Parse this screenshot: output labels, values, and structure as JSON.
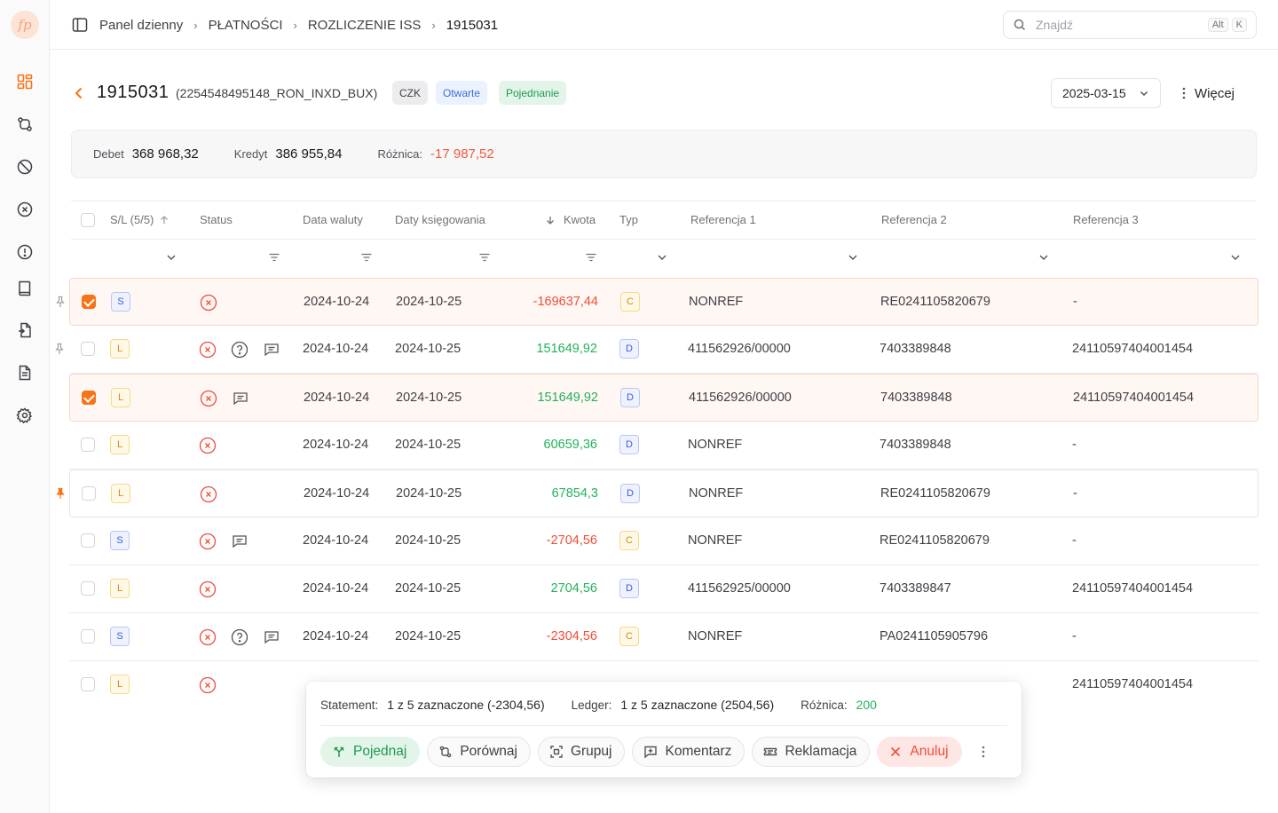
{
  "app": {
    "logo_text": "fp"
  },
  "sidebar": {
    "items": [
      {
        "icon": "dashboard-icon",
        "active": true
      },
      {
        "icon": "reconcile-icon"
      },
      {
        "icon": "ban-icon"
      },
      {
        "icon": "x-circle-icon"
      },
      {
        "icon": "alert-circle-icon"
      },
      {
        "icon": "book-icon"
      },
      {
        "icon": "file-swap-icon"
      },
      {
        "icon": "document-icon"
      },
      {
        "icon": "gear-icon"
      }
    ]
  },
  "breadcrumb": [
    "Panel dzienny",
    "PŁATNOŚCI",
    "ROZLICZENIE ISS",
    "1915031"
  ],
  "search": {
    "placeholder": "Znajdź",
    "shortcut": [
      "Alt",
      "K"
    ]
  },
  "header": {
    "id": "1915031",
    "subtitle": "(2254548495148_RON_INXD_BUX)",
    "tags": {
      "currency": "CZK",
      "status": "Otwarte",
      "type": "Pojednanie"
    },
    "date": "2025-03-15",
    "more_label": "Więcej"
  },
  "summary": {
    "debit_label": "Debet",
    "debit": "368 968,32",
    "credit_label": "Kredyt",
    "credit": "386 955,84",
    "diff_label": "Różnica:",
    "diff": "-17 987,52"
  },
  "table": {
    "columns": {
      "sl": "S/L (5/5)",
      "status": "Status",
      "value_date": "Data waluty",
      "booking_date": "Daty księgowania",
      "amount": "Kwota",
      "type": "Typ",
      "ref1": "Referencja 1",
      "ref2": "Referencja 2",
      "ref3": "Referencja 3"
    },
    "rows": [
      {
        "checked": true,
        "sl": "S",
        "value_date": "2024-10-24",
        "booking_date": "2024-10-25",
        "amount": "-169637,44",
        "type": "C",
        "ref1": "NONREF",
        "ref2": "RE0241105820679",
        "ref3": "-"
      },
      {
        "checked": false,
        "sl": "L",
        "value_date": "2024-10-24",
        "booking_date": "2024-10-25",
        "amount": "151649,92",
        "type": "D",
        "ref1": "411562926/00000",
        "ref2": "7403389848",
        "ref3": "24110597404001454"
      },
      {
        "checked": true,
        "sl": "L",
        "value_date": "2024-10-24",
        "booking_date": "2024-10-25",
        "amount": "151649,92",
        "type": "D",
        "ref1": "411562926/00000",
        "ref2": "7403389848",
        "ref3": "24110597404001454"
      },
      {
        "checked": false,
        "sl": "L",
        "value_date": "2024-10-24",
        "booking_date": "2024-10-25",
        "amount": "60659,36",
        "type": "D",
        "ref1": "NONREF",
        "ref2": "7403389848",
        "ref3": "-"
      },
      {
        "checked": false,
        "sl": "L",
        "value_date": "2024-10-24",
        "booking_date": "2024-10-25",
        "amount": "67854,3",
        "type": "D",
        "ref1": "NONREF",
        "ref2": "RE0241105820679",
        "ref3": "-"
      },
      {
        "checked": false,
        "sl": "S",
        "value_date": "2024-10-24",
        "booking_date": "2024-10-25",
        "amount": "-2704,56",
        "type": "C",
        "ref1": "NONREF",
        "ref2": "RE0241105820679",
        "ref3": "-"
      },
      {
        "checked": false,
        "sl": "L",
        "value_date": "2024-10-24",
        "booking_date": "2024-10-25",
        "amount": "2704,56",
        "type": "D",
        "ref1": "411562925/00000",
        "ref2": "7403389847",
        "ref3": "24110597404001454"
      },
      {
        "checked": false,
        "sl": "S",
        "value_date": "2024-10-24",
        "booking_date": "2024-10-25",
        "amount": "-2304,56",
        "type": "C",
        "ref1": "NONREF",
        "ref2": "PA0241105905796",
        "ref3": "-"
      },
      {
        "checked": false,
        "sl": "L",
        "ref3": "24110597404001454"
      }
    ]
  },
  "action_bar": {
    "statement_label": "Statement:",
    "statement_value": "1 z 5 zaznaczone (-2304,56)",
    "ledger_label": "Ledger:",
    "ledger_value": "1 z 5 zaznaczone (2504,56)",
    "diff_label": "Różnica:",
    "diff_value": "200",
    "buttons": {
      "match": "Pojednaj",
      "compare": "Porównaj",
      "group": "Grupuj",
      "comment": "Komentarz",
      "claim": "Reklamacja",
      "cancel": "Anuluj"
    }
  },
  "colors": {
    "accent": "#f97316",
    "positive": "#22b25a",
    "negative": "#ef4e3a"
  }
}
